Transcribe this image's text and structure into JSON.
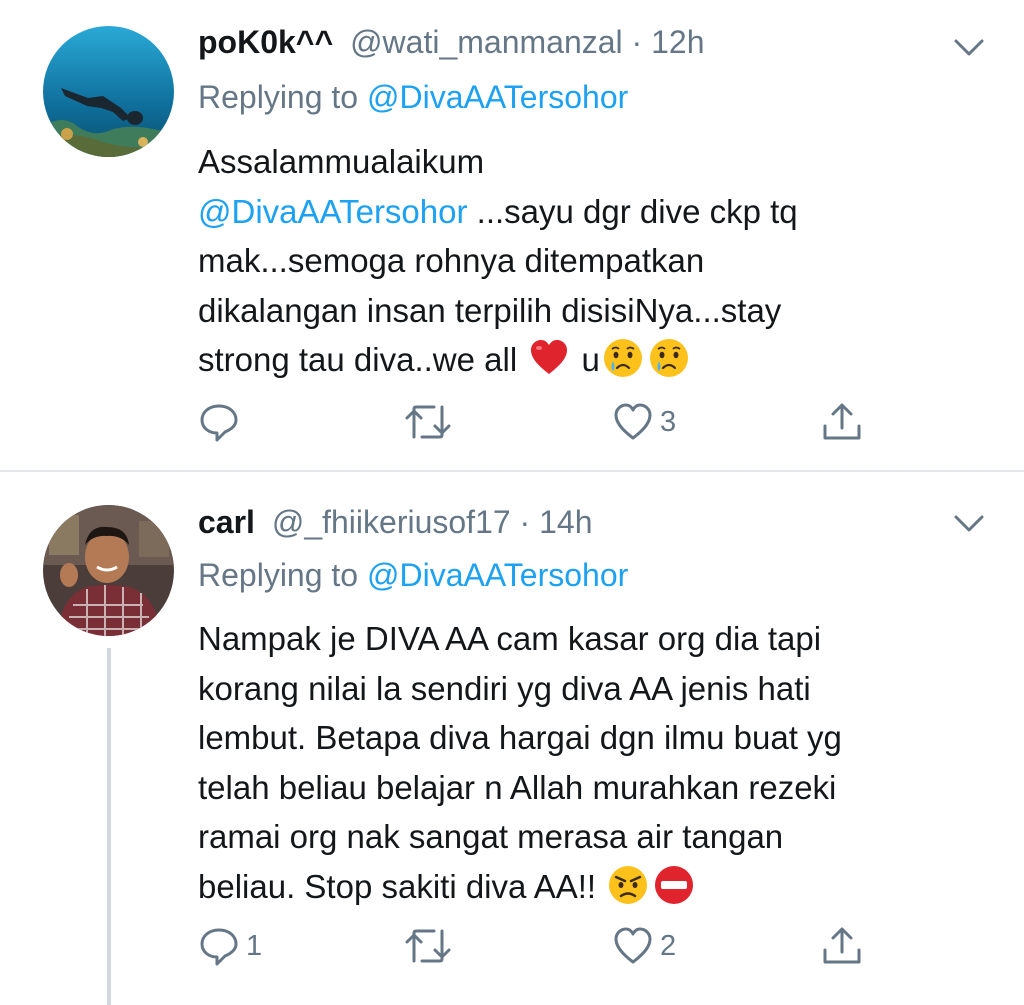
{
  "colors": {
    "link": "#1da1f2",
    "muted": "#657786",
    "text": "#14171a",
    "divider": "#e1e8ed"
  },
  "tweets": [
    {
      "name": "poK0k^^",
      "handle": "@wati_manmanzal",
      "time": "· 12h",
      "replying_prefix": "Replying to ",
      "replying_to": "@DivaAATersohor",
      "lines": [
        "Assalammualaikum",
        "@DivaAATersohor",
        " ...sayu dgr dive ckp tq",
        "mak...semoga rohnya ditempatkan",
        "dikalangan insan terpilih disisiNya...stay",
        "strong tau diva..we all ",
        " u"
      ],
      "emojis": [
        "red-heart-emoji",
        "crying-face-emoji",
        "crying-face-emoji"
      ],
      "reply_count": "",
      "like_count": "3"
    },
    {
      "name": "carl",
      "handle": "@_fhiikeriusof17",
      "time": "· 14h",
      "replying_prefix": "Replying to ",
      "replying_to": "@DivaAATersohor",
      "lines": [
        "Nampak je DIVA AA cam kasar org dia tapi",
        "korang nilai la sendiri yg diva AA jenis hati",
        "lembut. Betapa diva hargai dgn ilmu buat yg",
        "telah beliau belajar n Allah murahkan rezeki",
        "ramai org nak sangat merasa air tangan",
        "beliau. Stop sakiti diva AA!! "
      ],
      "emojis": [
        "angry-face-emoji",
        "no-entry-emoji"
      ],
      "reply_count": "1",
      "like_count": "2"
    }
  ]
}
